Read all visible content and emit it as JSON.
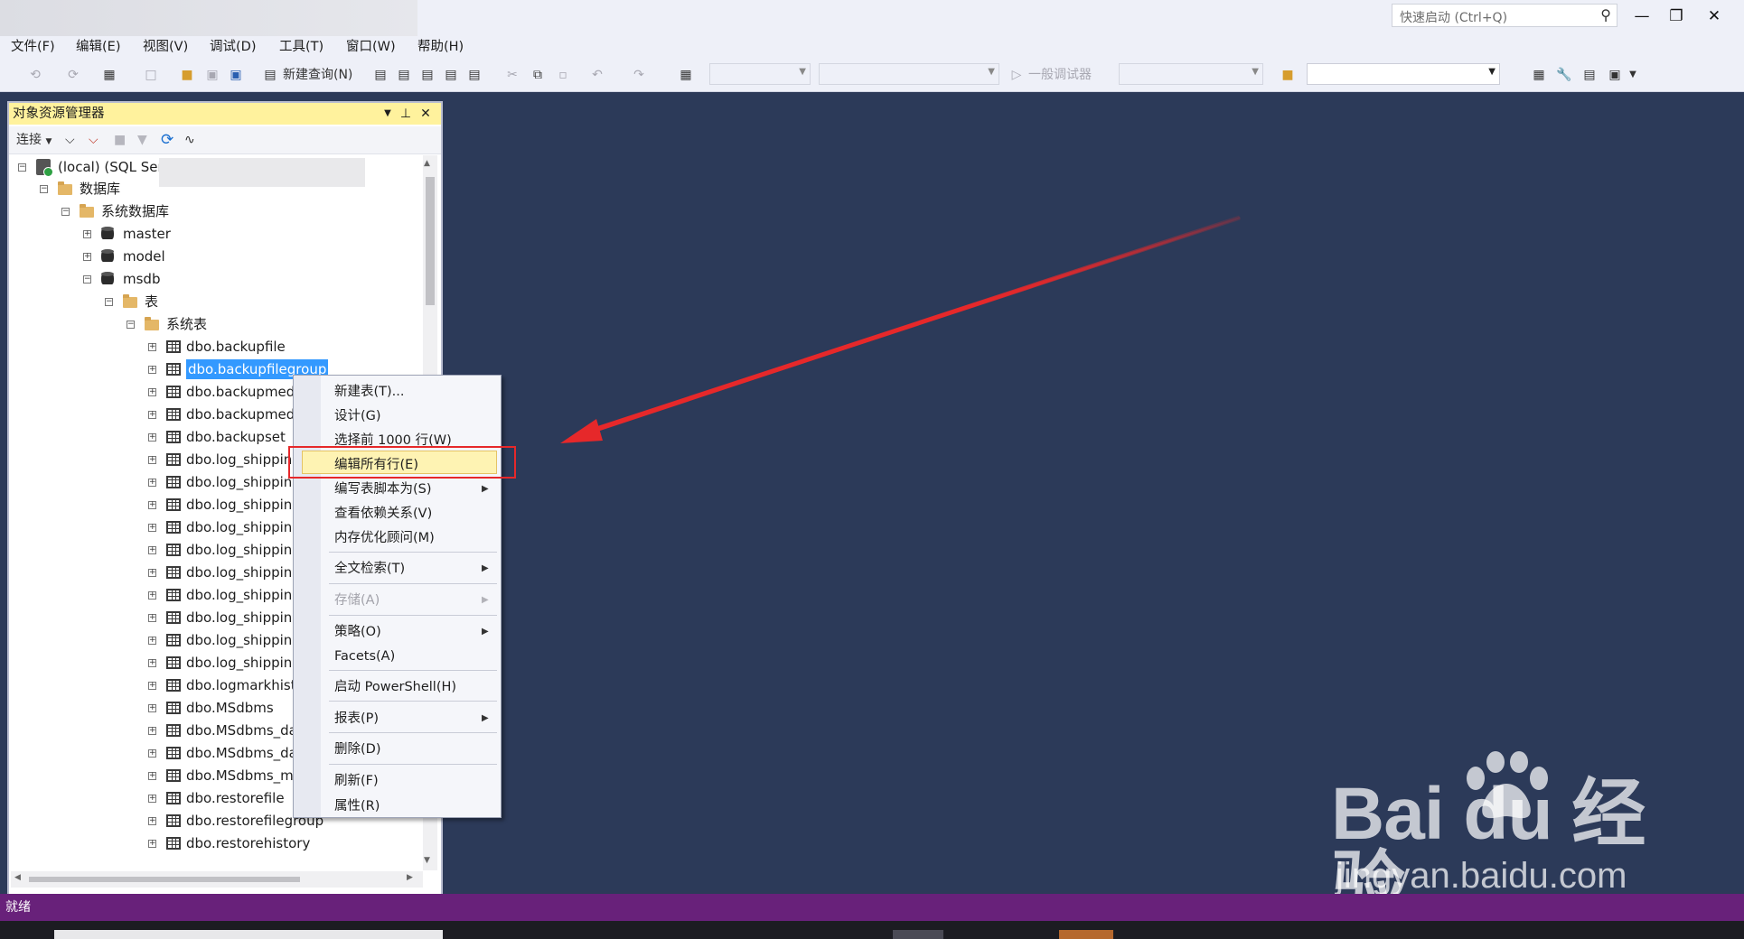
{
  "window": {
    "quick_launch_placeholder": "快速启动 (Ctrl+Q)"
  },
  "menu": [
    "文件(F)",
    "编辑(E)",
    "视图(V)",
    "调试(D)",
    "工具(T)",
    "窗口(W)",
    "帮助(H)"
  ],
  "toolbar": {
    "new_query": "新建查询(N)",
    "debugger": "一般调试器"
  },
  "object_explorer": {
    "title": "对象资源管理器",
    "connect": "连接",
    "tree": {
      "server": "(local) (SQL Ser",
      "databases": "数据库",
      "system_databases": "系统数据库",
      "master": "master",
      "model": "model",
      "msdb": "msdb",
      "tables": "表",
      "system_tables": "系统表",
      "items": [
        "dbo.backupfile",
        "dbo.backupfilegroup",
        "dbo.backupmed",
        "dbo.backupmed",
        "dbo.backupset",
        "dbo.log_shippin",
        "dbo.log_shippinc",
        "dbo.log_shippinc",
        "dbo.log_shippinc",
        "dbo.log_shippinc",
        "dbo.log_shippinc",
        "dbo.log_shippinc",
        "dbo.log_shippinc",
        "dbo.log_shippinc",
        "dbo.log_shippinc",
        "dbo.logmarkhist",
        "dbo.MSdbms",
        "dbo.MSdbms_da",
        "dbo.MSdbms_da",
        "dbo.MSdbms_ma",
        "dbo.restorefile",
        "dbo.restorefilegroup",
        "dbo.restorehistory"
      ]
    }
  },
  "context_menu": {
    "new_table": "新建表(T)...",
    "design": "设计(G)",
    "select_top": "选择前 1000 行(W)",
    "edit_all": "编辑所有行(E)",
    "script_as": "编写表脚本为(S)",
    "dependencies": "查看依赖关系(V)",
    "memory_advisor": "内存优化顾问(M)",
    "fulltext": "全文检索(T)",
    "storage": "存储(A)",
    "policies": "策略(O)",
    "facets": "Facets(A)",
    "powershell": "启动 PowerShell(H)",
    "reports": "报表(P)",
    "delete": "删除(D)",
    "refresh": "刷新(F)",
    "properties": "属性(R)"
  },
  "status": {
    "text": "就绪"
  },
  "watermark": {
    "brand": "Bai du 经验",
    "url": "jingyan.baidu.com"
  },
  "colors": {
    "status_bar": "#68217a",
    "highlight_box": "#e6282a",
    "arrow": "#e6282a",
    "selection": "#3399ff"
  }
}
